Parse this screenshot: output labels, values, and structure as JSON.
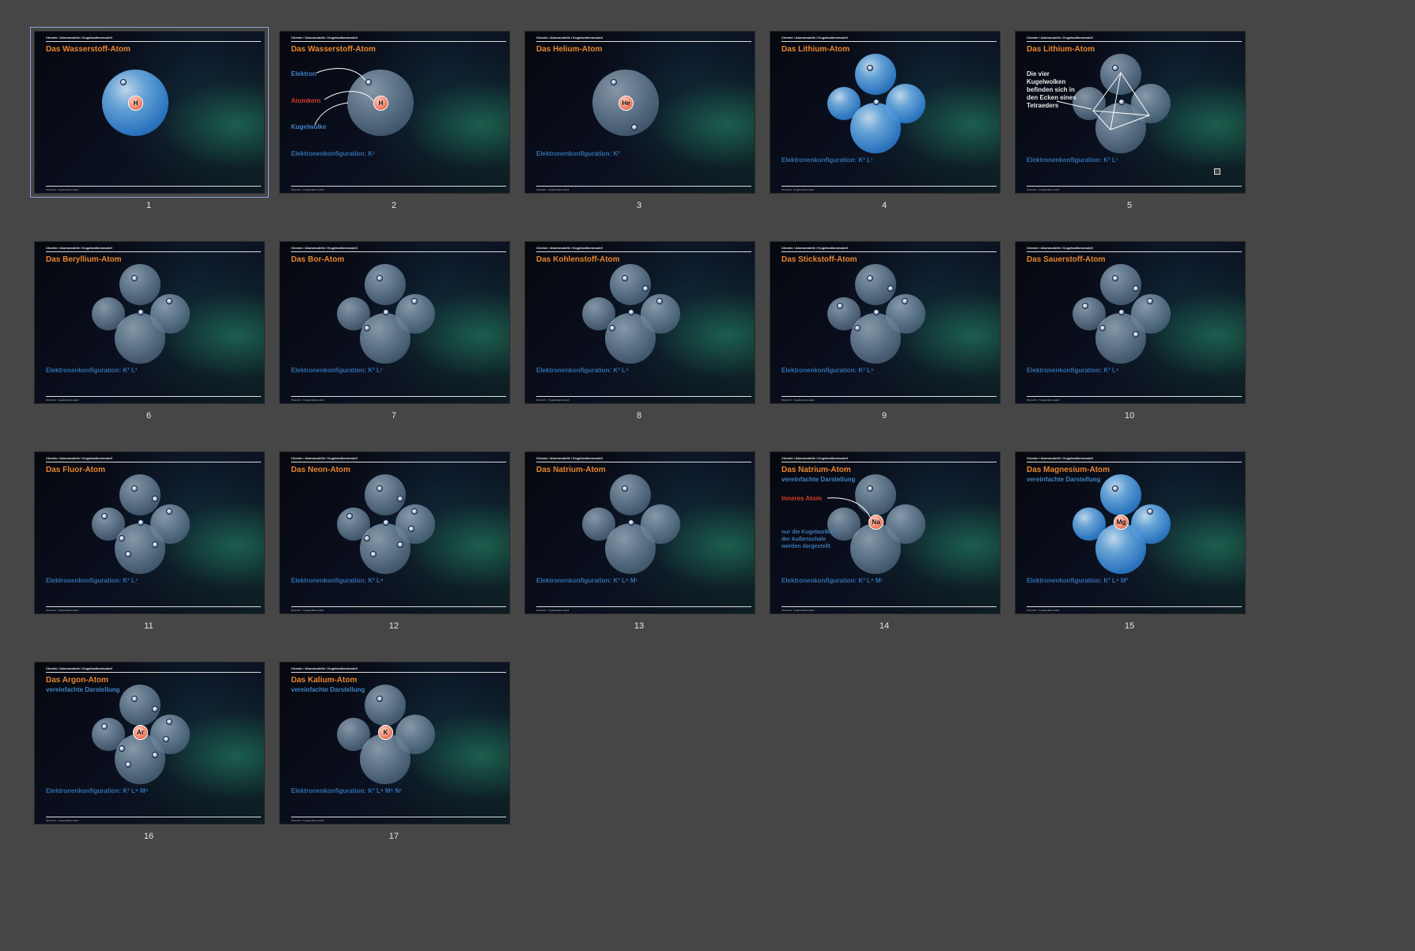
{
  "slides": [
    {
      "number": "1",
      "title": "Das Wasserstoff-Atom",
      "config": "",
      "crumb": "Chemie / Atommodelle / Kugelwolkenmodell",
      "footer": "Übersicht · Kugelwolkenmodell",
      "selected": true
    },
    {
      "number": "2",
      "title": "Das Wasserstoff-Atom",
      "config": "Elektronenkonfiguration: K¹",
      "crumb": "Chemie / Atommodelle / Kugelwolkenmodell",
      "footer": "Übersicht · Kugelwolkenmodell",
      "labels": {
        "electron": "Elektron",
        "nucleus": "Atomkern",
        "cloud": "Kugelwolke"
      }
    },
    {
      "number": "3",
      "title": "Das Helium-Atom",
      "config": "Elektronenkonfiguration: K²",
      "crumb": "Chemie / Atommodelle / Kugelwolkenmodell",
      "footer": "Übersicht · Kugelwolkenmodell"
    },
    {
      "number": "4",
      "title": "Das Lithium-Atom",
      "config": "Elektronenkonfiguration: K² L¹",
      "crumb": "Chemie / Atommodelle / Kugelwolkenmodell",
      "footer": "Übersicht · Kugelwolkenmodell"
    },
    {
      "number": "5",
      "title": "Das Lithium-Atom",
      "config": "Elektronenkonfiguration: K² L¹",
      "crumb": "Chemie / Atommodelle / Kugelwolkenmodell",
      "footer": "Übersicht · Kugelwolkenmodell",
      "note": [
        "Die vier",
        "Kugelwolken",
        "befinden sich in",
        "den Ecken eines",
        "Tetraeders"
      ]
    },
    {
      "number": "6",
      "title": "Das Beryllium-Atom",
      "config": "Elektronenkonfiguration: K² L²",
      "crumb": "Chemie / Atommodelle / Kugelwolkenmodell",
      "footer": "Übersicht · Kugelwolkenmodell"
    },
    {
      "number": "7",
      "title": "Das Bor-Atom",
      "config": "Elektronenkonfiguration: K² L³",
      "crumb": "Chemie / Atommodelle / Kugelwolkenmodell",
      "footer": "Übersicht · Kugelwolkenmodell"
    },
    {
      "number": "8",
      "title": "Das Kohlenstoff-Atom",
      "config": "Elektronenkonfiguration: K² L⁴",
      "crumb": "Chemie / Atommodelle / Kugelwolkenmodell",
      "footer": "Übersicht · Kugelwolkenmodell"
    },
    {
      "number": "9",
      "title": "Das Stickstoff-Atom",
      "config": "Elektronenkonfiguration: K² L⁵",
      "crumb": "Chemie / Atommodelle / Kugelwolkenmodell",
      "footer": "Übersicht · Kugelwolkenmodell"
    },
    {
      "number": "10",
      "title": "Das Sauerstoff-Atom",
      "config": "Elektronenkonfiguration: K² L⁶",
      "crumb": "Chemie / Atommodelle / Kugelwolkenmodell",
      "footer": "Übersicht · Kugelwolkenmodell"
    },
    {
      "number": "11",
      "title": "Das Fluor-Atom",
      "config": "Elektronenkonfiguration: K² L⁷",
      "crumb": "Chemie / Atommodelle / Kugelwolkenmodell",
      "footer": "Übersicht · Kugelwolkenmodell"
    },
    {
      "number": "12",
      "title": "Das Neon-Atom",
      "config": "Elektronenkonfiguration: K² L⁸",
      "crumb": "Chemie / Atommodelle / Kugelwolkenmodell",
      "footer": "Übersicht · Kugelwolkenmodell"
    },
    {
      "number": "13",
      "title": "Das Natrium-Atom",
      "config": "Elektronenkonfiguration: K² L⁸ M¹",
      "crumb": "Chemie / Atommodelle / Kugelwolkenmodell",
      "footer": "Übersicht · Kugelwolkenmodell"
    },
    {
      "number": "14",
      "title": "Das Natrium-Atom",
      "subtitle": "vereinfachte Darstellung",
      "config": "Elektronenkonfiguration: K² L⁸ M¹",
      "crumb": "Chemie / Atommodelle / Kugelwolkenmodell",
      "footer": "Übersicht · Kugelwolkenmodell",
      "labels": {
        "inner": "Inneres Atom",
        "outer": [
          "nur die Kugelwolken",
          "der Außenschale",
          "werden dargestellt"
        ]
      },
      "nucleus": "Na"
    },
    {
      "number": "15",
      "title": "Das Magnesium-Atom",
      "subtitle": "vereinfachte Darstellung",
      "config": "Elektronenkonfiguration: K² L⁸ M²",
      "crumb": "Chemie / Atommodelle / Kugelwolkenmodell",
      "footer": "Übersicht · Kugelwolkenmodell",
      "nucleus": "Mg"
    },
    {
      "number": "16",
      "title": "Das Argon-Atom",
      "subtitle": "vereinfachte Darstellung",
      "config": "Elektronenkonfiguration: K² L⁸ M⁸",
      "crumb": "Chemie / Atommodelle / Kugelwolkenmodell",
      "footer": "Übersicht · Kugelwolkenmodell",
      "nucleus": "Ar"
    },
    {
      "number": "17",
      "title": "Das Kalium-Atom",
      "subtitle": "vereinfachte Darstellung",
      "config": "Elektronenkonfiguration: K² L⁸ M⁸ N¹",
      "crumb": "Chemie / Atommodelle / Kugelwolkenmodell",
      "footer": "Übersicht · Kugelwolkenmodell",
      "nucleus": "K"
    }
  ],
  "single_nuclei": {
    "1": "H",
    "2": "H",
    "3": "He"
  }
}
